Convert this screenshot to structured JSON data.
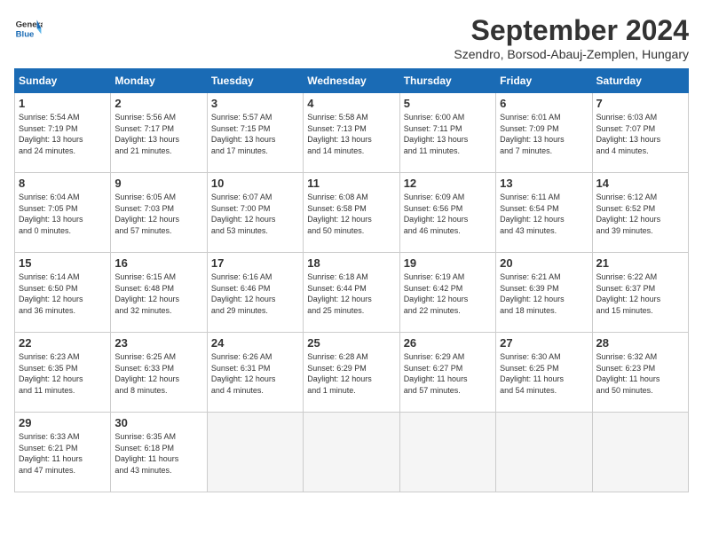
{
  "header": {
    "logo_line1": "General",
    "logo_line2": "Blue",
    "month_year": "September 2024",
    "location": "Szendro, Borsod-Abauj-Zemplen, Hungary"
  },
  "weekdays": [
    "Sunday",
    "Monday",
    "Tuesday",
    "Wednesday",
    "Thursday",
    "Friday",
    "Saturday"
  ],
  "weeks": [
    [
      {
        "day": "1",
        "info": "Sunrise: 5:54 AM\nSunset: 7:19 PM\nDaylight: 13 hours\nand 24 minutes."
      },
      {
        "day": "2",
        "info": "Sunrise: 5:56 AM\nSunset: 7:17 PM\nDaylight: 13 hours\nand 21 minutes."
      },
      {
        "day": "3",
        "info": "Sunrise: 5:57 AM\nSunset: 7:15 PM\nDaylight: 13 hours\nand 17 minutes."
      },
      {
        "day": "4",
        "info": "Sunrise: 5:58 AM\nSunset: 7:13 PM\nDaylight: 13 hours\nand 14 minutes."
      },
      {
        "day": "5",
        "info": "Sunrise: 6:00 AM\nSunset: 7:11 PM\nDaylight: 13 hours\nand 11 minutes."
      },
      {
        "day": "6",
        "info": "Sunrise: 6:01 AM\nSunset: 7:09 PM\nDaylight: 13 hours\nand 7 minutes."
      },
      {
        "day": "7",
        "info": "Sunrise: 6:03 AM\nSunset: 7:07 PM\nDaylight: 13 hours\nand 4 minutes."
      }
    ],
    [
      {
        "day": "8",
        "info": "Sunrise: 6:04 AM\nSunset: 7:05 PM\nDaylight: 13 hours\nand 0 minutes."
      },
      {
        "day": "9",
        "info": "Sunrise: 6:05 AM\nSunset: 7:03 PM\nDaylight: 12 hours\nand 57 minutes."
      },
      {
        "day": "10",
        "info": "Sunrise: 6:07 AM\nSunset: 7:00 PM\nDaylight: 12 hours\nand 53 minutes."
      },
      {
        "day": "11",
        "info": "Sunrise: 6:08 AM\nSunset: 6:58 PM\nDaylight: 12 hours\nand 50 minutes."
      },
      {
        "day": "12",
        "info": "Sunrise: 6:09 AM\nSunset: 6:56 PM\nDaylight: 12 hours\nand 46 minutes."
      },
      {
        "day": "13",
        "info": "Sunrise: 6:11 AM\nSunset: 6:54 PM\nDaylight: 12 hours\nand 43 minutes."
      },
      {
        "day": "14",
        "info": "Sunrise: 6:12 AM\nSunset: 6:52 PM\nDaylight: 12 hours\nand 39 minutes."
      }
    ],
    [
      {
        "day": "15",
        "info": "Sunrise: 6:14 AM\nSunset: 6:50 PM\nDaylight: 12 hours\nand 36 minutes."
      },
      {
        "day": "16",
        "info": "Sunrise: 6:15 AM\nSunset: 6:48 PM\nDaylight: 12 hours\nand 32 minutes."
      },
      {
        "day": "17",
        "info": "Sunrise: 6:16 AM\nSunset: 6:46 PM\nDaylight: 12 hours\nand 29 minutes."
      },
      {
        "day": "18",
        "info": "Sunrise: 6:18 AM\nSunset: 6:44 PM\nDaylight: 12 hours\nand 25 minutes."
      },
      {
        "day": "19",
        "info": "Sunrise: 6:19 AM\nSunset: 6:42 PM\nDaylight: 12 hours\nand 22 minutes."
      },
      {
        "day": "20",
        "info": "Sunrise: 6:21 AM\nSunset: 6:39 PM\nDaylight: 12 hours\nand 18 minutes."
      },
      {
        "day": "21",
        "info": "Sunrise: 6:22 AM\nSunset: 6:37 PM\nDaylight: 12 hours\nand 15 minutes."
      }
    ],
    [
      {
        "day": "22",
        "info": "Sunrise: 6:23 AM\nSunset: 6:35 PM\nDaylight: 12 hours\nand 11 minutes."
      },
      {
        "day": "23",
        "info": "Sunrise: 6:25 AM\nSunset: 6:33 PM\nDaylight: 12 hours\nand 8 minutes."
      },
      {
        "day": "24",
        "info": "Sunrise: 6:26 AM\nSunset: 6:31 PM\nDaylight: 12 hours\nand 4 minutes."
      },
      {
        "day": "25",
        "info": "Sunrise: 6:28 AM\nSunset: 6:29 PM\nDaylight: 12 hours\nand 1 minute."
      },
      {
        "day": "26",
        "info": "Sunrise: 6:29 AM\nSunset: 6:27 PM\nDaylight: 11 hours\nand 57 minutes."
      },
      {
        "day": "27",
        "info": "Sunrise: 6:30 AM\nSunset: 6:25 PM\nDaylight: 11 hours\nand 54 minutes."
      },
      {
        "day": "28",
        "info": "Sunrise: 6:32 AM\nSunset: 6:23 PM\nDaylight: 11 hours\nand 50 minutes."
      }
    ],
    [
      {
        "day": "29",
        "info": "Sunrise: 6:33 AM\nSunset: 6:21 PM\nDaylight: 11 hours\nand 47 minutes."
      },
      {
        "day": "30",
        "info": "Sunrise: 6:35 AM\nSunset: 6:18 PM\nDaylight: 11 hours\nand 43 minutes."
      },
      {
        "day": "",
        "info": ""
      },
      {
        "day": "",
        "info": ""
      },
      {
        "day": "",
        "info": ""
      },
      {
        "day": "",
        "info": ""
      },
      {
        "day": "",
        "info": ""
      }
    ]
  ]
}
